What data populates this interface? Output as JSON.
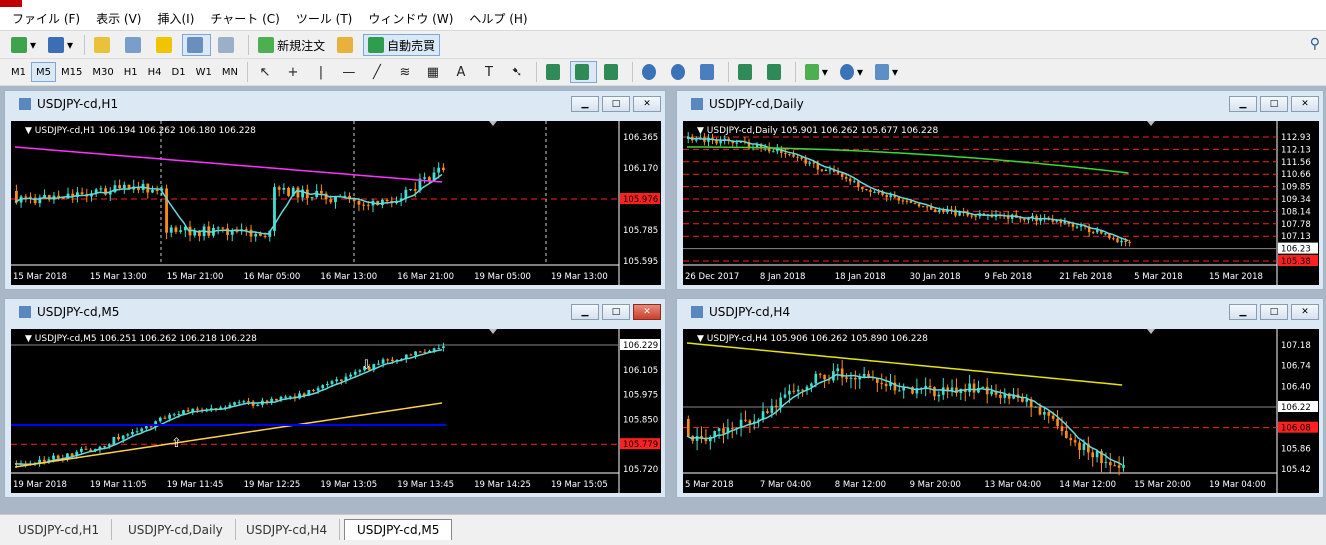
{
  "menu": [
    "ファイル (F)",
    "表示 (V)",
    "挿入(I)",
    "チャート (C)",
    "ツール (T)",
    "ウィンドウ (W)",
    "ヘルプ (H)"
  ],
  "toolbar": {
    "new_order": "新規注文",
    "auto_trading": "自動売買"
  },
  "timeframes": [
    "M1",
    "M5",
    "M15",
    "M30",
    "H1",
    "H4",
    "D1",
    "W1",
    "MN"
  ],
  "active_timeframe": "M5",
  "drawing_tools": [
    "cursor-icon",
    "crosshair-icon",
    "vertical-line-icon",
    "horizontal-line-icon",
    "trendline-icon",
    "fibonacci-icon",
    "channel-icon",
    "text-icon",
    "text-label-icon",
    "arrow-icon"
  ],
  "charts": [
    {
      "key": "h1",
      "title": "USDJPY-cd,H1",
      "info": "USDJPY-cd,H1  106.194 106.262 106.180 106.228",
      "prices": [
        "106.365",
        "106.170",
        "105.976",
        "105.785",
        "105.595"
      ],
      "current_price": "106.228",
      "red_price": "105.976",
      "times": [
        "15 Mar 2018",
        "15 Mar 13:00",
        "15 Mar 21:00",
        "16 Mar 05:00",
        "16 Mar 13:00",
        "16 Mar 21:00",
        "19 Mar 05:00",
        "19 Mar 13:00"
      ]
    },
    {
      "key": "daily",
      "title": "USDJPY-cd,Daily",
      "info": "USDJPY-cd,Daily  105.901 106.262 105.677 106.228",
      "prices": [
        "112.93",
        "112.13",
        "111.56",
        "110.66",
        "109.85",
        "109.34",
        "108.14",
        "107.78",
        "107.13",
        "106.23",
        "105.38"
      ],
      "current_price": "106.23",
      "red_price": "105.38",
      "times": [
        "26 Dec 2017",
        "8 Jan 2018",
        "18 Jan 2018",
        "30 Jan 2018",
        "9 Feb 2018",
        "21 Feb 2018",
        "5 Mar 2018",
        "15 Mar 2018"
      ]
    },
    {
      "key": "m5",
      "title": "USDJPY-cd,M5",
      "info": "USDJPY-cd,M5  106.251 106.262 106.218 106.228",
      "prices": [
        "106.229",
        "106.105",
        "105.975",
        "105.850",
        "105.779",
        "105.720"
      ],
      "current_price": "106.229",
      "red_price": "105.779",
      "times": [
        "19 Mar 2018",
        "19 Mar 11:05",
        "19 Mar 11:45",
        "19 Mar 12:25",
        "19 Mar 13:05",
        "19 Mar 13:45",
        "19 Mar 14:25",
        "19 Mar 15:05"
      ]
    },
    {
      "key": "h4",
      "title": "USDJPY-cd,H4",
      "info": "USDJPY-cd,H4  105.906 106.262 105.890 106.228",
      "prices": [
        "107.18",
        "106.74",
        "106.40",
        "106.22",
        "106.08",
        "105.86",
        "105.42"
      ],
      "current_price": "106.22",
      "red_price": "106.08",
      "times": [
        "5 Mar 2018",
        "7 Mar 04:00",
        "8 Mar 12:00",
        "9 Mar 20:00",
        "13 Mar 04:00",
        "14 Mar 12:00",
        "15 Mar 20:00",
        "19 Mar 04:00"
      ]
    }
  ],
  "tabs": [
    "USDJPY-cd,H1",
    "USDJPY-cd,Daily",
    "USDJPY-cd,H4",
    "USDJPY-cd,M5"
  ],
  "active_tab": "USDJPY-cd,M5",
  "colors": {
    "bull": "#40e0d0",
    "bear": "#ff8c1a",
    "ma_fast": "#66d9d9",
    "ma_slow_h1": "#ff33ff",
    "ma_slow_daily": "#33dd33",
    "ma_slow_h4": "#e6e600",
    "ma_blue": "#0000ff",
    "level": "#ff2020"
  }
}
